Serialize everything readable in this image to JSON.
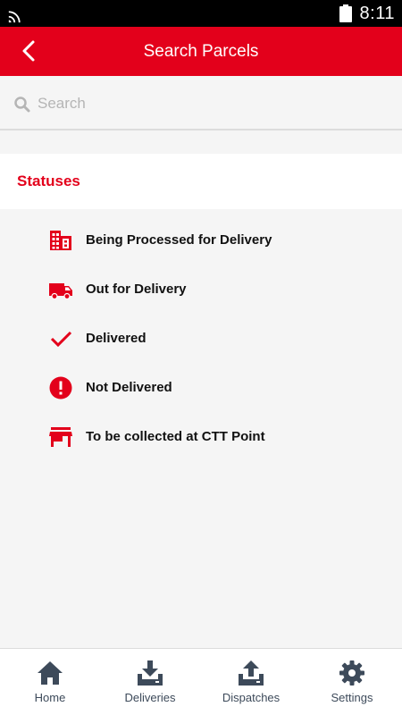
{
  "status_bar": {
    "time": "8:11",
    "icons": [
      "wifi-icon",
      "battery-icon"
    ]
  },
  "app_bar": {
    "title": "Search Parcels",
    "back_icon": "chevron-left-icon",
    "background_color": "#e3001b"
  },
  "search": {
    "placeholder": "Search",
    "value": "",
    "icon": "search-icon"
  },
  "statuses": {
    "header": "Statuses",
    "accent_color": "#e3001b",
    "items": [
      {
        "label": "Being Processed for Delivery",
        "icon": "building-icon"
      },
      {
        "label": "Out for Delivery",
        "icon": "truck-icon"
      },
      {
        "label": "Delivered",
        "icon": "checkmark-icon"
      },
      {
        "label": "Not Delivered",
        "icon": "alert-circle-icon"
      },
      {
        "label": "To be collected at CTT Point",
        "icon": "store-icon"
      }
    ]
  },
  "bottom_nav": {
    "items": [
      {
        "label": "Home",
        "icon": "home-icon"
      },
      {
        "label": "Deliveries",
        "icon": "download-tray-icon"
      },
      {
        "label": "Dispatches",
        "icon": "upload-tray-icon"
      },
      {
        "label": "Settings",
        "icon": "gear-icon"
      }
    ],
    "icon_color": "#3d4a5a"
  }
}
